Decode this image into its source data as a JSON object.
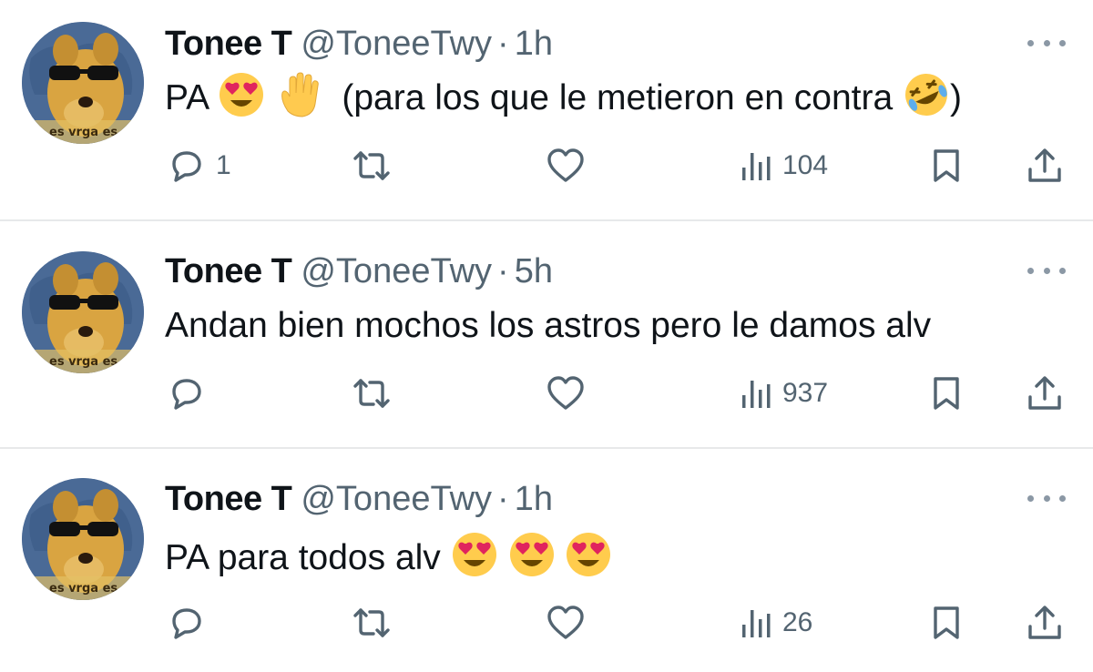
{
  "tweets": [
    {
      "name": "Tonee T",
      "handle": "@ToneeTwy",
      "separator": "·",
      "time": "1h",
      "text_before": "PA",
      "text_middle": "(para los que le metieron en contra",
      "text_after": ")",
      "avatar_caption": "es vrga es",
      "replies": "1",
      "retweets": "",
      "likes": "",
      "views": "104"
    },
    {
      "name": "Tonee T",
      "handle": "@ToneeTwy",
      "separator": "·",
      "time": "5h",
      "text": "Andan bien mochos los astros pero le damos alv",
      "avatar_caption": "es vrga es",
      "replies": "",
      "retweets": "",
      "likes": "",
      "views": "937"
    },
    {
      "name": "Tonee T",
      "handle": "@ToneeTwy",
      "separator": "·",
      "time": "1h",
      "text": "PA para todos alv",
      "avatar_caption": "es vrga es",
      "replies": "",
      "retweets": "",
      "likes": "",
      "views": "26"
    }
  ],
  "colors": {
    "text_primary": "#0f1419",
    "text_secondary": "#536471",
    "divider": "#e7e9ea",
    "icon": "#536471"
  },
  "icons": [
    "reply-icon",
    "retweet-icon",
    "like-icon",
    "views-icon",
    "bookmark-icon",
    "share-icon",
    "more-icon"
  ],
  "emojis": [
    "heart-eyes-emoji",
    "raised-hand-emoji",
    "rolling-laughing-emoji"
  ]
}
